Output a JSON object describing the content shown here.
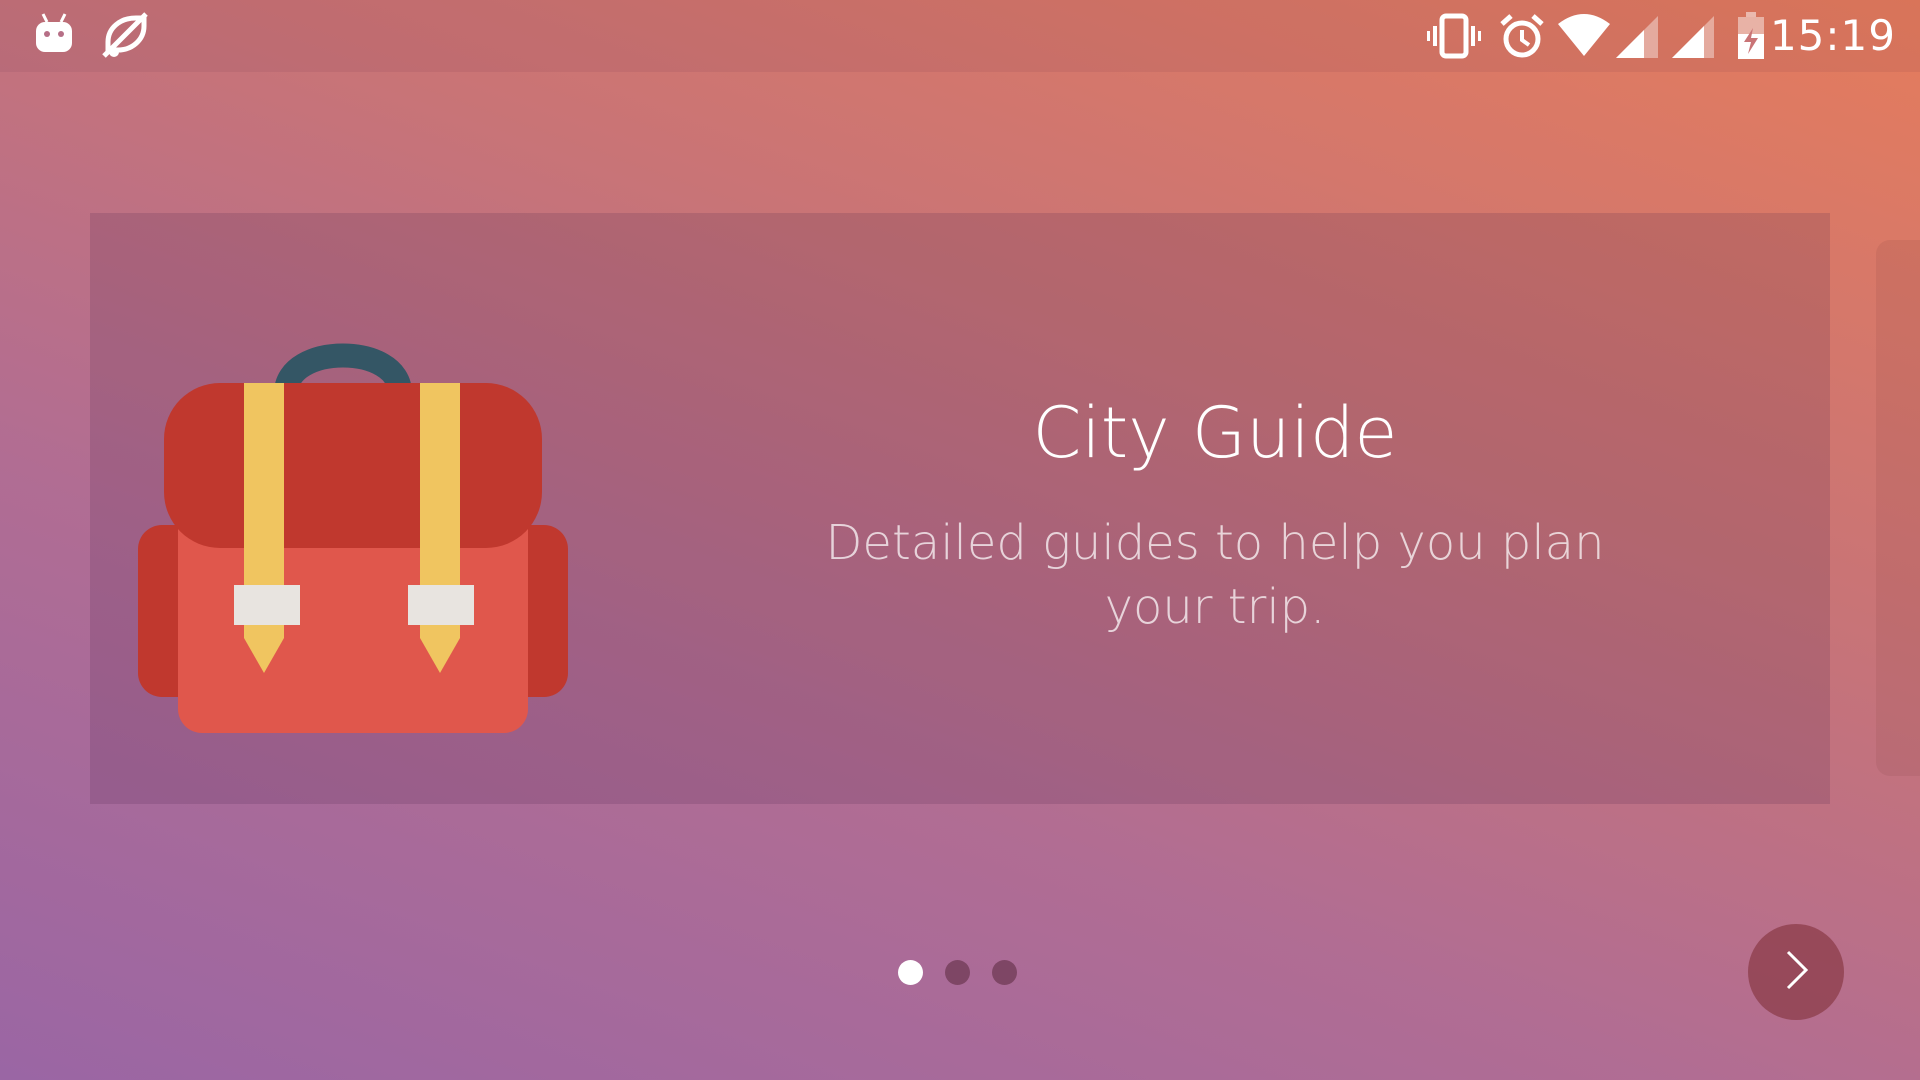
{
  "status_bar": {
    "time": "15:19",
    "left_icons": [
      "android-debug-icon",
      "notifications-off-icon"
    ],
    "right_icons": [
      "vibrate-icon",
      "alarm-icon",
      "wifi-icon",
      "signal-icon",
      "signal-icon-2",
      "battery-charging-icon"
    ]
  },
  "slide": {
    "title": "City Guide",
    "description": "Detailed guides to help you plan your trip.",
    "illustration": "backpack-icon"
  },
  "pager": {
    "total": 3,
    "current": 1
  },
  "next_button": {
    "icon": "chevron-right-icon"
  },
  "colors": {
    "background_start": "#9a66a4",
    "background_end": "#e57c5c",
    "backpack_red": "#e0574c",
    "backpack_dark_red": "#c0382e",
    "strap_yellow": "#f0c560",
    "handle_dark": "#345665"
  }
}
